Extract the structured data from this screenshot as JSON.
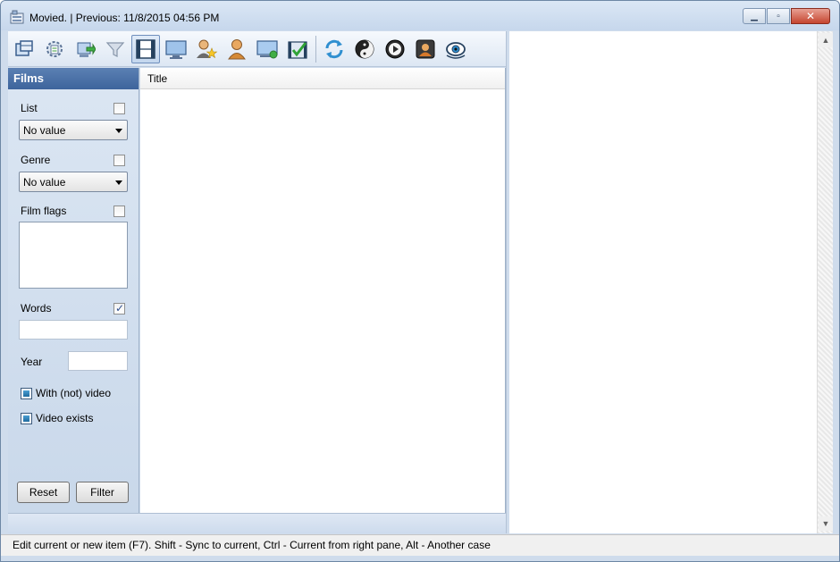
{
  "window": {
    "title": "Movied. | Previous: 11/8/2015 04:56 PM",
    "buttons": {
      "minimize_icon": "minimize-icon",
      "maximize_icon": "maximize-icon",
      "close_icon": "close-icon"
    }
  },
  "toolbar": {
    "buttons": [
      {
        "icon": "table-icon",
        "active": false
      },
      {
        "icon": "settings-gear-icon",
        "active": false
      },
      {
        "icon": "import-icon",
        "active": false
      },
      {
        "icon": "filter-funnel-icon",
        "active": false
      },
      {
        "icon": "film-icon",
        "active": true
      },
      {
        "icon": "monitor-icon",
        "active": false
      },
      {
        "icon": "person-star-icon",
        "active": false
      },
      {
        "icon": "person-icon",
        "active": false
      },
      {
        "icon": "screen-add-icon",
        "active": false
      },
      {
        "icon": "film-check-icon",
        "active": false
      },
      {
        "icon": "refresh-icon",
        "active": false
      },
      {
        "icon": "yin-yang-icon",
        "active": false
      },
      {
        "icon": "play-icon",
        "active": false
      },
      {
        "icon": "portrait-frame-icon",
        "active": false
      },
      {
        "icon": "eye-icon",
        "active": false
      }
    ]
  },
  "left_panel": {
    "header": "Films",
    "list": {
      "label": "List",
      "checked": false,
      "value": "No value"
    },
    "genre": {
      "label": "Genre",
      "checked": false,
      "value": "No value"
    },
    "film_flags": {
      "label": "Film flags",
      "checked": false
    },
    "words": {
      "label": "Words",
      "checked": true,
      "value": ""
    },
    "year": {
      "label": "Year",
      "value": ""
    },
    "with_video": {
      "label": "With (not) video",
      "checked": true
    },
    "video_exists": {
      "label": "Video exists",
      "checked": true
    },
    "reset_label": "Reset",
    "filter_label": "Filter"
  },
  "grid": {
    "columns": [
      "Title"
    ]
  },
  "colors": {
    "panel_header": "#3d649c",
    "frame": "#cfdcec",
    "accent": "#4b9fd3"
  },
  "statusbar": {
    "text": "Edit current or new item (F7). Shift - Sync to current, Ctrl - Current from right pane, Alt - Another case"
  }
}
